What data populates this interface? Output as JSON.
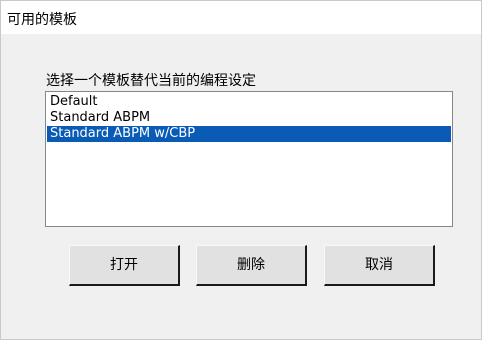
{
  "window": {
    "title": "可用的模板"
  },
  "prompt": "选择一个模板替代当前的编程设定",
  "templates": [
    {
      "label": "Default",
      "selected": false
    },
    {
      "label": "Standard ABPM",
      "selected": false
    },
    {
      "label": "Standard ABPM w/CBP",
      "selected": true
    }
  ],
  "buttons": {
    "open": "打开",
    "delete": "删除",
    "cancel": "取消"
  },
  "colors": {
    "selection": "#0a5bb5",
    "dialog_background": "#f0f0f0",
    "title_background": "#ffffff"
  }
}
